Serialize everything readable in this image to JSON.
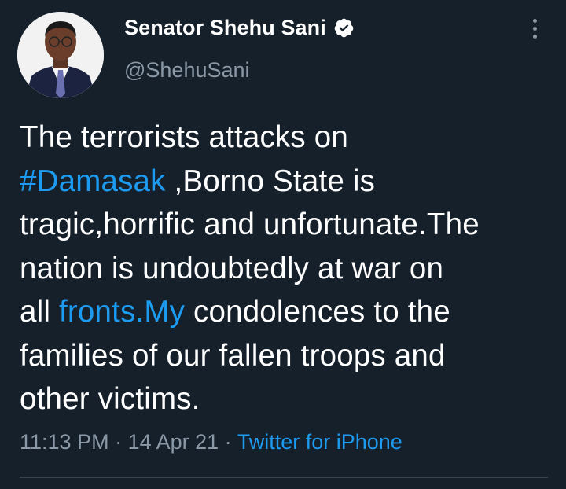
{
  "author": {
    "display_name": "Senator Shehu Sani",
    "handle": "@ShehuSani",
    "verified_icon": "verified-badge-icon"
  },
  "tweet": {
    "lines": [
      [
        {
          "text": "The terrorists attacks on",
          "link": false
        }
      ],
      [
        {
          "text": "#Damasak",
          "link": true
        },
        {
          "text": " ,Borno State is",
          "link": false
        }
      ],
      [
        {
          "text": "tragic,horrific and unfortunate.The",
          "link": false
        }
      ],
      [
        {
          "text": "nation is undoubtedly at war on",
          "link": false
        }
      ],
      [
        {
          "text": "all ",
          "link": false
        },
        {
          "text": "fronts.My",
          "link": true
        },
        {
          "text": " condolences to the",
          "link": false
        }
      ],
      [
        {
          "text": "families of our fallen troops and",
          "link": false
        }
      ],
      [
        {
          "text": "other victims.",
          "link": false
        }
      ]
    ]
  },
  "meta": {
    "time": "11:13 PM",
    "separator": " · ",
    "date": "14 Apr 21",
    "source": "Twitter for iPhone"
  },
  "colors": {
    "background": "#15202b",
    "link": "#1d9bf0",
    "secondary_text": "#8b98a5"
  }
}
